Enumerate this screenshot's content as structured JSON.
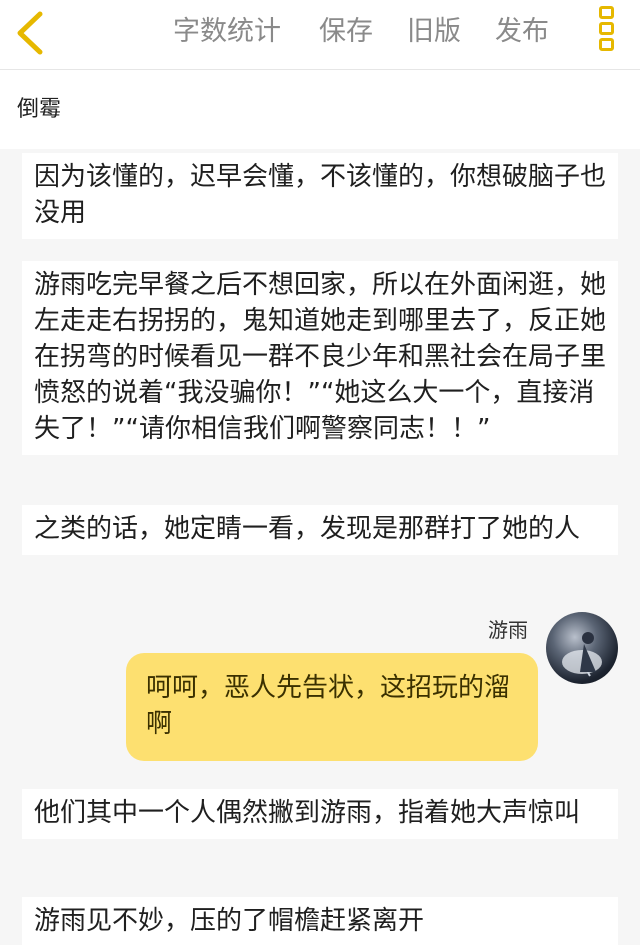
{
  "header": {
    "back_label": "back",
    "word_count_label": "字数统计",
    "save_label": "保存",
    "old_version_label": "旧版",
    "publish_label": "发布"
  },
  "chapter": {
    "title": "倒霉"
  },
  "paragraphs": [
    "因为该懂的，迟早会懂，不该懂的，你想破脑子也没用",
    "游雨吃完早餐之后不想回家，所以在外面闲逛，她左走走右拐拐的，鬼知道她走到哪里去了，反正她在拐弯的时候看见一群不良少年和黑社会在局子里愤怒的说着“我没骗你！”“她这么大一个，直接消失了！”“请你相信我们啊警察同志！！”",
    "之类的话，她定睛一看，发现是那群打了她的人",
    "他们其中一个人偶然撇到游雨，指着她大声惊叫",
    "游雨见不妙，压的了帽檐赶紧离开"
  ],
  "dialogue": {
    "speaker": "游雨",
    "text": "呵呵，恶人先告状，这招玩的溜啊"
  },
  "colors": {
    "accent": "#e6b800",
    "bubble": "#fde070",
    "menu_text": "#8a8a8a",
    "content_bg": "#f6f6f6"
  },
  "icons": {
    "back": "chevron-left-icon",
    "more": "more-vertical-icon"
  }
}
